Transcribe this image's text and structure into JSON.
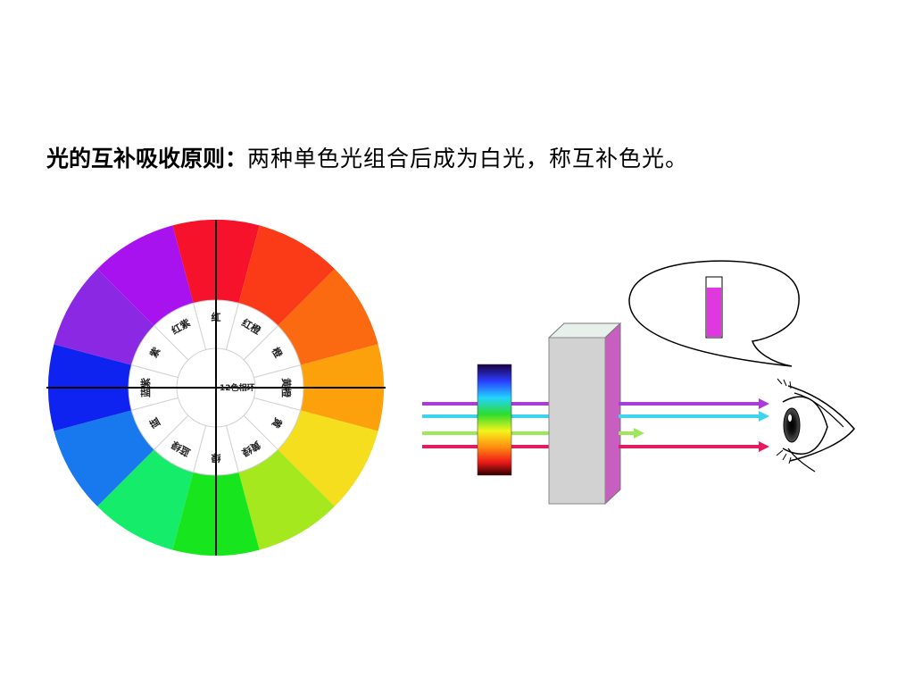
{
  "title": {
    "bold": "光的互补吸收原则：",
    "rest": "两种单色光组合后成为白光，称互补色光。"
  },
  "color_wheel": {
    "center_label": "12色相环",
    "segments": [
      {
        "label": "红",
        "color": "#f5122a"
      },
      {
        "label": "红橙",
        "color": "#fb3a17"
      },
      {
        "label": "橙",
        "color": "#fb6a10"
      },
      {
        "label": "黄橙",
        "color": "#fca10b"
      },
      {
        "label": "黄",
        "color": "#f5de1d"
      },
      {
        "label": "黄绿",
        "color": "#a5e81e"
      },
      {
        "label": "绿",
        "color": "#17e51d"
      },
      {
        "label": "蓝绿",
        "color": "#15ec6a"
      },
      {
        "label": "蓝",
        "color": "#1878ee"
      },
      {
        "label": "蓝紫",
        "color": "#0f23f0"
      },
      {
        "label": "紫",
        "color": "#8a28e4"
      },
      {
        "label": "红紫",
        "color": "#a712ef"
      }
    ]
  },
  "absorption": {
    "beam_colors": [
      "#a83cd8",
      "#3ed4ee",
      "#9ce85a",
      "#e31c5e"
    ],
    "solution_color": "#de38de",
    "cuvette_color": "#d2d2d2",
    "cuvette_tint": "#c75fc0"
  }
}
